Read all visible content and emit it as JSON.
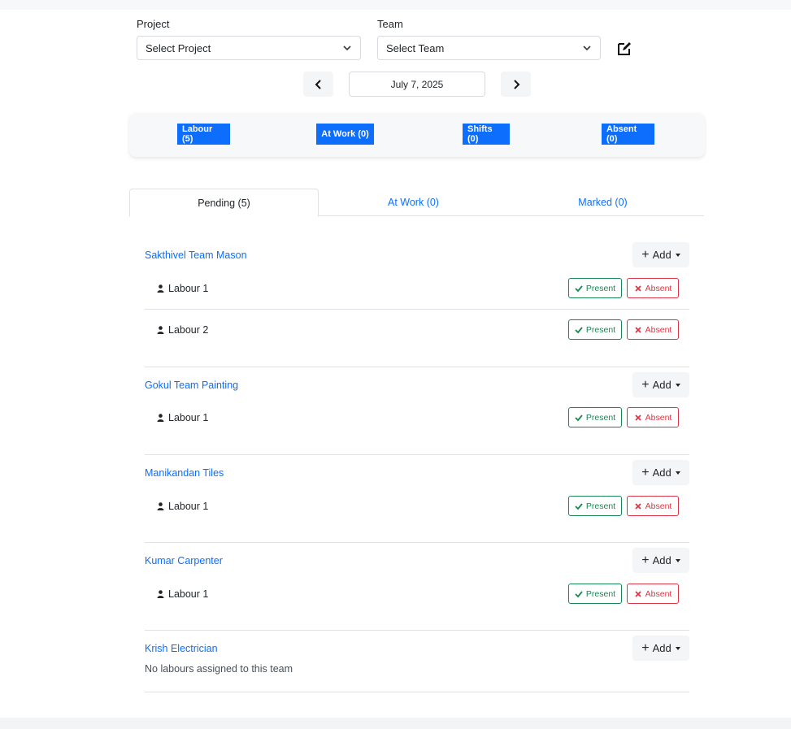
{
  "filters": {
    "project_label": "Project",
    "project_value": "Select Project",
    "team_label": "Team",
    "team_value": "Select Team"
  },
  "date_nav": {
    "date": "July 7, 2025"
  },
  "summary": {
    "labour": "Labour (5)",
    "at_work": "At Work (0)",
    "shifts": "Shifts (0)",
    "absent": "Absent (0)",
    "accent_color": "#0d6efd"
  },
  "tabs": [
    {
      "label": "Pending (5)"
    },
    {
      "label": "At Work (0)"
    },
    {
      "label": "Marked (0)"
    }
  ],
  "actions": {
    "add": "Add",
    "present": "Present",
    "absent": "Absent"
  },
  "teams": [
    {
      "name": "Sakthivel Team Mason",
      "labours": [
        "Labour 1",
        "Labour 2"
      ]
    },
    {
      "name": "Gokul Team Painting",
      "labours": [
        "Labour 1"
      ]
    },
    {
      "name": "Manikandan Tiles",
      "labours": [
        "Labour 1"
      ]
    },
    {
      "name": "Kumar Carpenter",
      "labours": [
        "Labour 1"
      ]
    },
    {
      "name": "Krish Electrician",
      "labours": [],
      "empty_message": "No labours assigned to this team"
    }
  ],
  "colors": {
    "present": "#198754",
    "absent": "#dc3545",
    "link": "#0d6efd"
  }
}
